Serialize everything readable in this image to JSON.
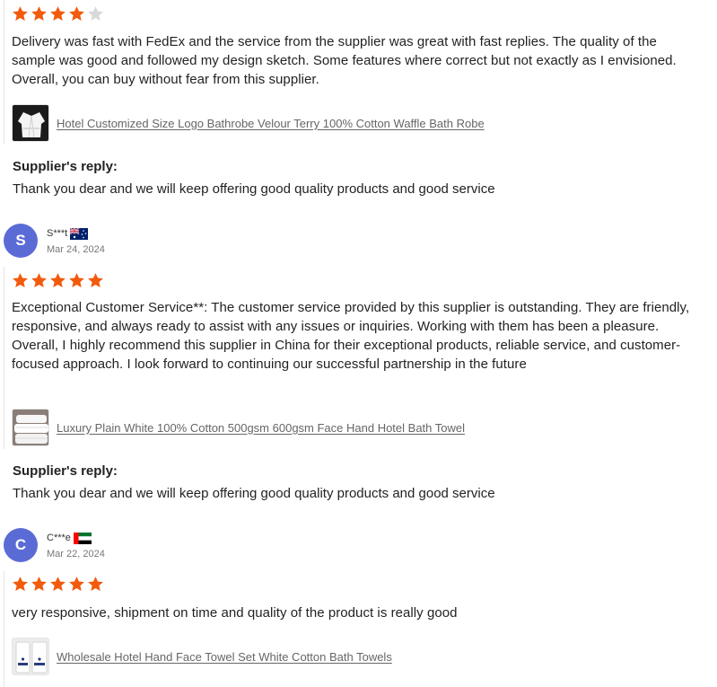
{
  "colors": {
    "star_filled": "#f25a0c",
    "star_empty": "#d9d9d9",
    "avatar_bg": "#5b6bd6",
    "link": "#666666"
  },
  "reviews": [
    {
      "rating": 4,
      "max_rating": 5,
      "text": "Delivery was fast with FedEx and the service from the supplier was great with fast replies. The quality of the sample was good and followed my design sketch. Some features where correct but not exactly as I envisioned. Overall, you can buy without fear from this supplier.",
      "product": {
        "title": "Hotel Customized Size Logo Bathrobe Velour Terry 100% Cotton Waffle Bath Robe",
        "thumb_icon": "bathrobe-thumbnail"
      },
      "reply": {
        "title": "Supplier's reply:",
        "text": "Thank you dear and we will keep offering good quality products and good service"
      }
    },
    {
      "reviewer": {
        "initial": "S",
        "name": "S***t",
        "country_flag": "australia-flag-icon"
      },
      "date": "Mar 24, 2024",
      "rating": 5,
      "max_rating": 5,
      "text": "Exceptional Customer Service**: The customer service provided by this supplier is outstanding. They are friendly, responsive, and always ready to assist with any issues or inquiries. Working with them has been a pleasure. Overall, I highly recommend this supplier in China for their exceptional products, reliable service, and customer-focused approach. I look forward to continuing our successful partnership in the future",
      "product": {
        "title": "Luxury Plain White 100% Cotton 500gsm 600gsm Face Hand Hotel Bath Towel",
        "thumb_icon": "towel-stack-thumbnail"
      },
      "reply": {
        "title": "Supplier's reply:",
        "text": "Thank you dear and we will keep offering good quality products and good service"
      }
    },
    {
      "reviewer": {
        "initial": "C",
        "name": "C***e",
        "country_flag": "uae-flag-icon"
      },
      "date": "Mar 22, 2024",
      "rating": 5,
      "max_rating": 5,
      "text": "very responsive, shipment on time and quality of the product is really good",
      "product": {
        "title": "Wholesale Hotel Hand Face Towel Set White Cotton Bath Towels",
        "thumb_icon": "hotel-towels-thumbnail"
      }
    }
  ]
}
